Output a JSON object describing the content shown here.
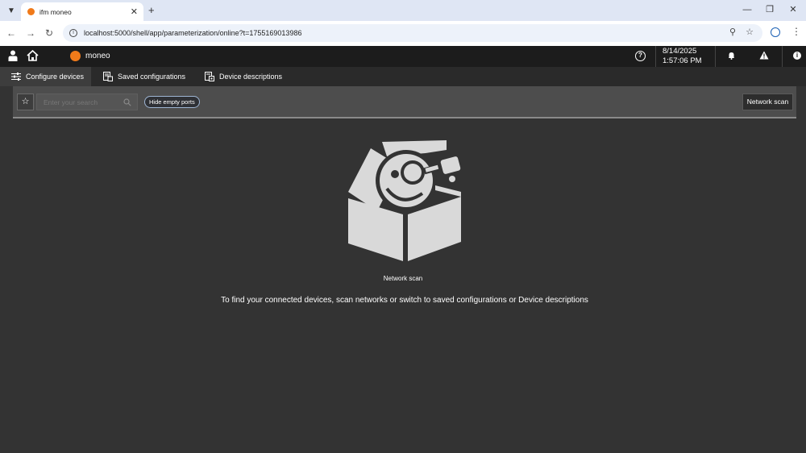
{
  "browser": {
    "tab_title": "ifm moneo",
    "url": "localhost:5000/shell/app/parameterization/online?t=1755169013986",
    "icons": [
      "tab-list-icon",
      "close-tab-icon",
      "new-tab-icon",
      "minimize-icon",
      "restore-icon",
      "close-window-icon",
      "back-icon",
      "forward-icon",
      "reload-icon",
      "site-info-icon",
      "zoom-icon",
      "bookmark-star-icon",
      "profile-icon",
      "kebab-menu-icon"
    ]
  },
  "header": {
    "brand": "moneo",
    "date": "8/14/2025",
    "time": "1:57:06 PM",
    "icons": [
      "user-icon",
      "home-icon",
      "help-icon",
      "bell-icon",
      "warning-icon",
      "info-icon"
    ]
  },
  "tabs": [
    {
      "label": "Configure devices",
      "icon": "sliders-icon",
      "active": true
    },
    {
      "label": "Saved configurations",
      "icon": "saved-config-icon",
      "active": false
    },
    {
      "label": "Device descriptions",
      "icon": "device-description-icon",
      "active": false
    }
  ],
  "filter": {
    "search_placeholder": "Enter your search",
    "chip_label": "Hide empty ports",
    "scan_button": "Network scan"
  },
  "empty_state": {
    "caption": "Network scan",
    "message": "To find your connected devices, scan networks or switch to saved configurations or Device descriptions"
  },
  "colors": {
    "accent": "#f07a1a",
    "app_bg": "#333333",
    "header_bg": "#1c1c1c",
    "filter_bar_bg": "#4d4d4d",
    "illustration": "#d9d9d9"
  }
}
